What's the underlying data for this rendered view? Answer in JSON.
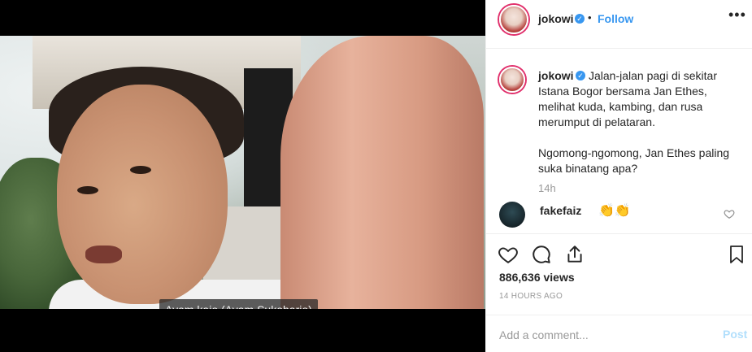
{
  "media": {
    "subtitle": "Ayam kajo (Ayam Sukoharjo)"
  },
  "header": {
    "username": "jokowi",
    "dot": "•",
    "follow_label": "Follow",
    "more_icon": "more-horizontal-icon"
  },
  "caption": {
    "username": "jokowi",
    "paragraphs": [
      "Jalan-jalan pagi di sekitar Istana Bogor bersama Jan Ethes, melihat kuda, kambing, dan rusa merumput di pelataran.",
      "Ngomong-ngomong, Jan Ethes paling suka binatang apa?"
    ],
    "time": "14h"
  },
  "comment": {
    "username": "fakefaiz",
    "text": "👏👏"
  },
  "actions": {
    "icons": [
      "heart-icon",
      "comment-icon",
      "share-icon",
      "bookmark-icon"
    ]
  },
  "stats": {
    "views": "886,636 views",
    "posted_ago": "14 HOURS AGO"
  },
  "add_comment": {
    "placeholder": "Add a comment...",
    "post_label": "Post"
  },
  "colors": {
    "link_blue": "#3897f0",
    "post_disabled": "#b2dffc",
    "muted": "#999999"
  }
}
